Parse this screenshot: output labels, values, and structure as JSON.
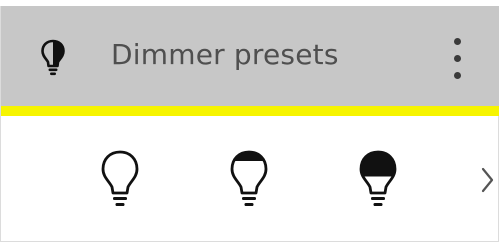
{
  "header": {
    "title": "Dimmer presets",
    "icon": "bulb-half-icon",
    "menu_icon": "more-vert-icon",
    "background": "#c7c7c7",
    "accent": "#f6f400"
  },
  "presets": [
    {
      "icon": "bulb-off-icon",
      "level": 0
    },
    {
      "icon": "bulb-dim-icon",
      "level": 0.3
    },
    {
      "icon": "bulb-bright-icon",
      "level": 0.7
    }
  ],
  "navigation": {
    "next_icon": "chevron-right-icon"
  }
}
